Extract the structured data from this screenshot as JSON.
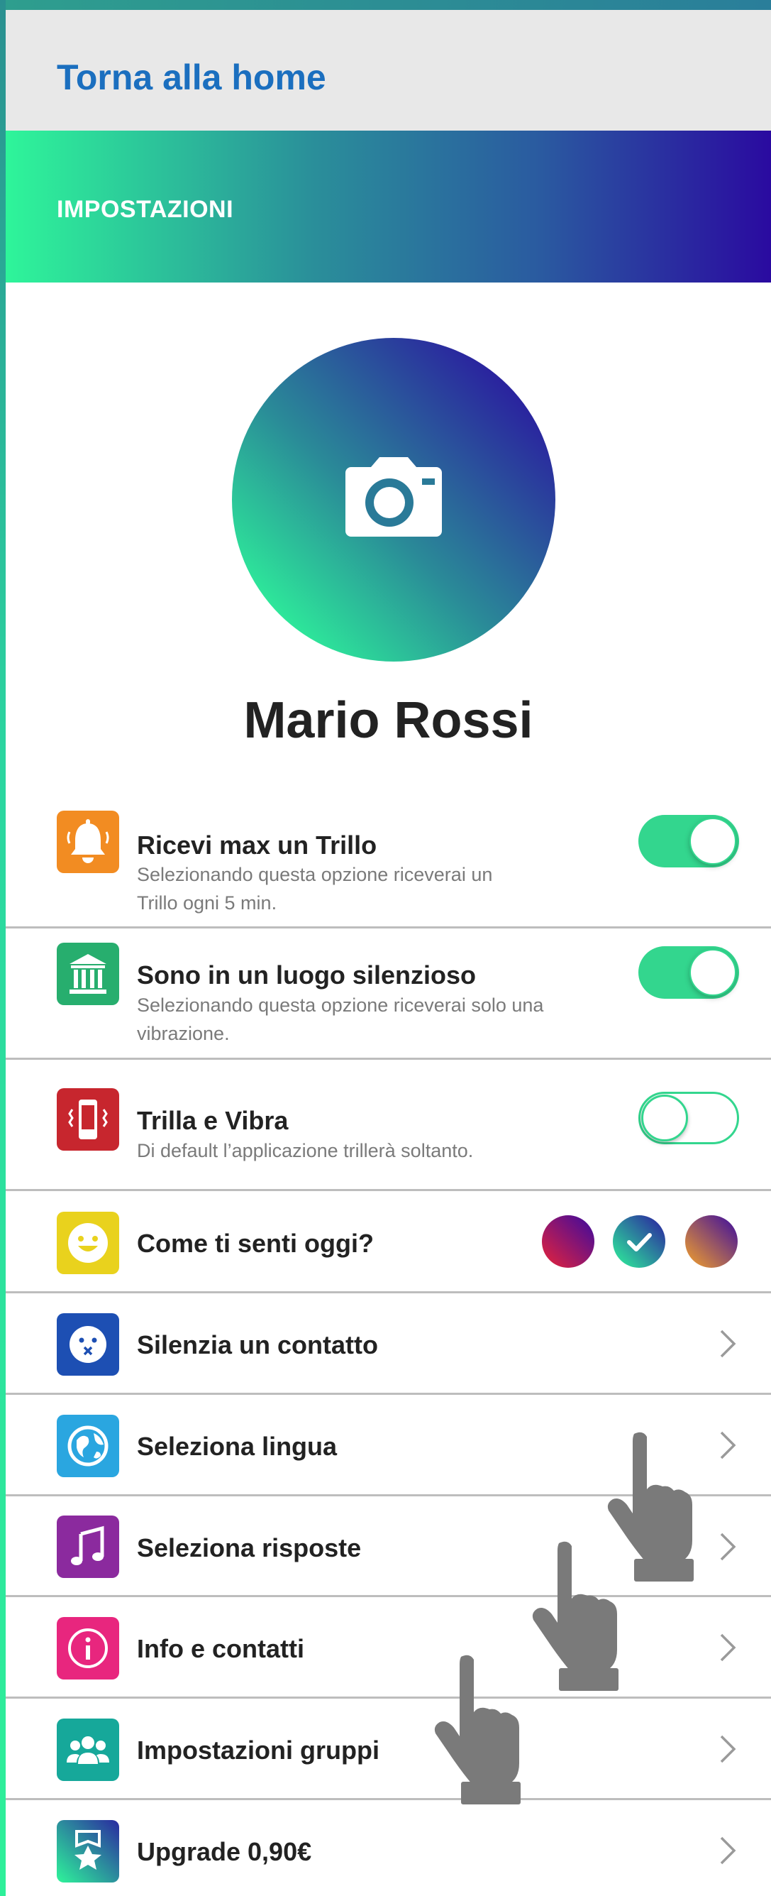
{
  "header": {
    "back_label": "Torna alla home"
  },
  "banner": {
    "title": "IMPOSTAZIONI"
  },
  "profile": {
    "name": "Mario Rossi",
    "avatar_icon": "camera-icon"
  },
  "settings": {
    "max_trillo": {
      "title": "Ricevi max un Trillo",
      "subtitle": "Selezionando questa opzione riceverai un Trillo ogni 5 min.",
      "enabled": true,
      "icon": "bell-icon",
      "color": "#f28c22"
    },
    "silent_place": {
      "title": "Sono in un luogo silenzioso",
      "subtitle": "Selezionando questa opzione riceverai solo una vibrazione.",
      "enabled": true,
      "icon": "building-icon",
      "color": "#27ae6e"
    },
    "ring_vibrate": {
      "title": "Trilla e Vibra",
      "subtitle": "Di default l’applicazione trillerà soltanto.",
      "enabled": false,
      "icon": "phone-vibrate-icon",
      "color": "#c7262e"
    },
    "mood": {
      "title": "Come ti senti oggi?",
      "icon": "smiley-icon",
      "color": "#e9d21d",
      "options": [
        "red-purple",
        "green-blue",
        "orange-purple"
      ],
      "selected": "green-blue"
    }
  },
  "menu": [
    {
      "label": "Silenzia un contatto",
      "icon": "muted-face-icon",
      "color": "#1d4fb3"
    },
    {
      "label": "Seleziona lingua",
      "icon": "globe-icon",
      "color": "#2aa6e0"
    },
    {
      "label": "Seleziona risposte",
      "icon": "music-note-icon",
      "color": "#8b2a9e"
    },
    {
      "label": "Info e contatti",
      "icon": "info-icon",
      "color": "#e8267e"
    },
    {
      "label": "Impostazioni gruppi",
      "icon": "group-icon",
      "color": "#16a89a"
    },
    {
      "label": "Upgrade 0,90€",
      "icon": "star-badge-icon",
      "color": "#1aa88a"
    }
  ],
  "colors": {
    "accent": "#1b6fbf",
    "toggle_on": "#33d68e",
    "banner_start": "#2ef59a",
    "banner_end": "#2a0aa0"
  }
}
